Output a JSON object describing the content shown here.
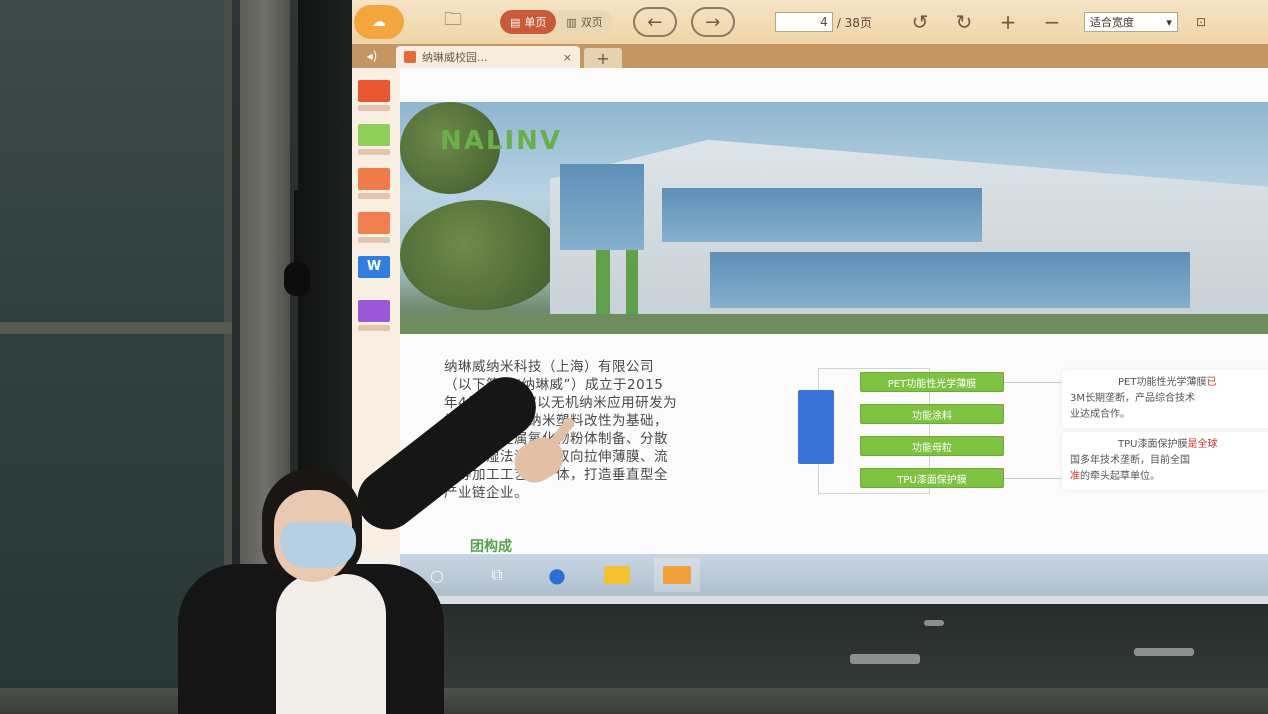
{
  "viewer": {
    "tabs": {
      "single_page": "单页",
      "double_page": "双页"
    },
    "page": {
      "current": "4",
      "total": "/ 38页"
    },
    "zoom_select": "适合宽度",
    "tab_title": "纳琳威校园...",
    "tab_close": "×",
    "tab_add": "+"
  },
  "slide": {
    "hero_logo": "NALINV",
    "intro_lines": [
      "纳琳威纳米科技（上海）有限公司",
      "（以下简称“纳琳威”）成立于2015",
      "年4月，是一家以无机纳米应用研发为",
      "核心，以无机纳米塑料改性为基础，",
      "集合纳米金属氧化物粉体制备、分散",
      "研磨、湿法涂布、双向拉伸薄膜、流",
      "延等加工工艺为一体，打造垂直型全",
      "产业链企业。"
    ],
    "products": [
      "PET功能性光学薄膜",
      "功能涂料",
      "功能母粒",
      "TPU漆面保护膜"
    ],
    "desc_1_lead": "PET功能性光学薄膜",
    "desc_1_red": "已",
    "desc_1_line2": "3M长期垄断，产品综合技术",
    "desc_1_line3": "业达成合作。",
    "desc_2_lead": "TPU漆面保护膜",
    "desc_2_red": "是全球",
    "desc_2_line2": "国多年技术垄断，目前全国",
    "desc_2_red2": "准",
    "desc_2_line3": "的牵头起草单位。",
    "footer_text": "团构成"
  }
}
